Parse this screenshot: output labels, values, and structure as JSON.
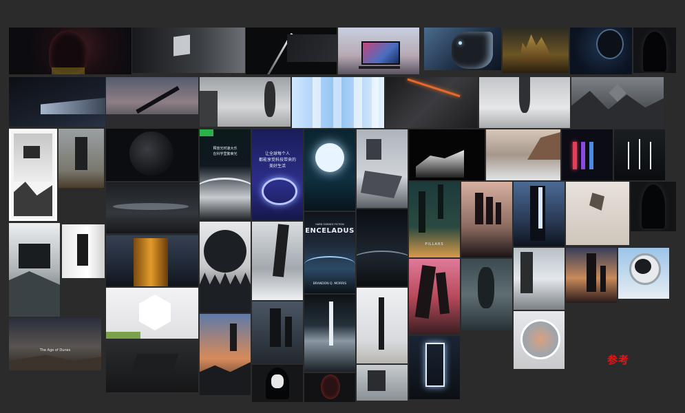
{
  "canvas": {
    "background": "#2b2b2b",
    "label": "参考",
    "label_color": "#e01818"
  },
  "posters": {
    "chinese_headline_1": "释放光时速大乐",
    "chinese_headline_2": "在科学里繁荣光",
    "chinese_headline_3": "让全球每个人",
    "chinese_headline_4": "都能享受科技带来的",
    "chinese_headline_5": "美好生活",
    "enceladus_top": "HARD SCIENCE FICTION",
    "enceladus_title": "ENCELADUS",
    "enceladus_author": "BRANDON Q. MORRIS",
    "pillars_title": "PILLARS",
    "age_title": "The Age of Dunes"
  }
}
